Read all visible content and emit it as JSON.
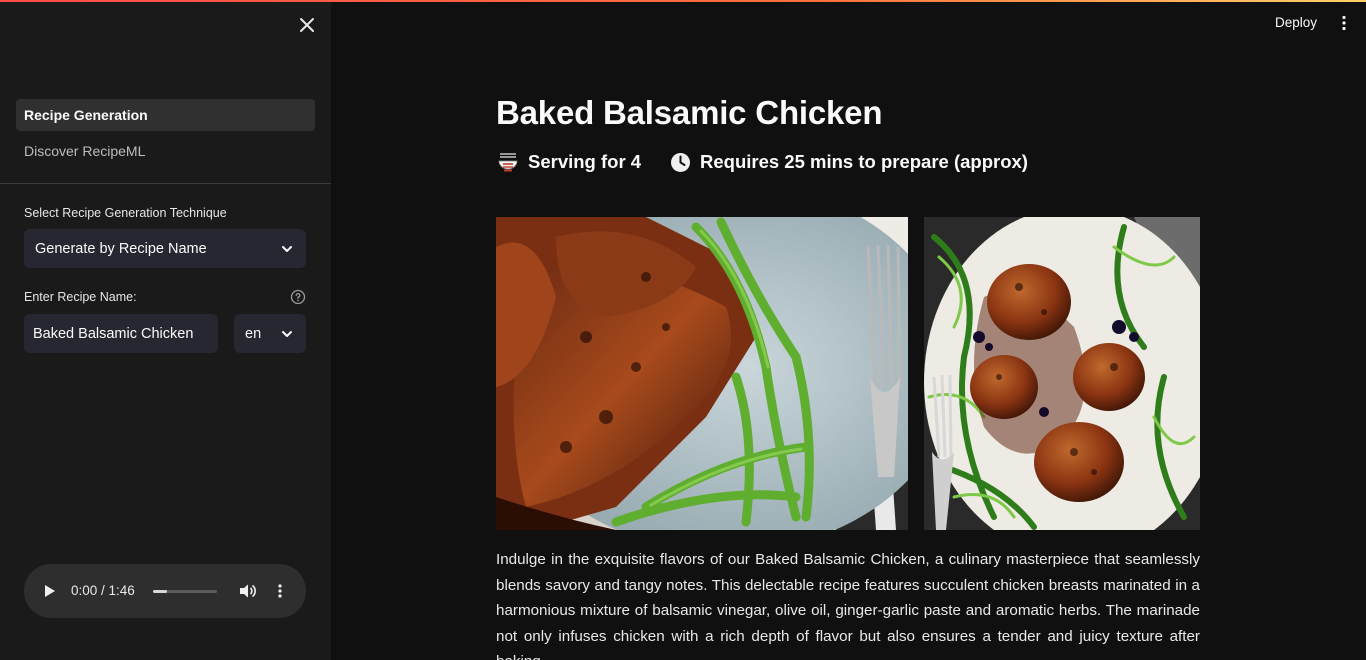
{
  "sidebar": {
    "nav": [
      {
        "label": "Recipe Generation",
        "active": true
      },
      {
        "label": "Discover RecipeML",
        "active": false
      }
    ],
    "technique_label": "Select Recipe Generation Technique",
    "technique_value": "Generate by Recipe Name",
    "name_label": "Enter Recipe Name:",
    "name_value": "Baked Balsamic Chicken",
    "language_value": "en",
    "audio": {
      "time": "0:00 / 1:46",
      "progress": 0.22
    }
  },
  "header": {
    "deploy_label": "Deploy"
  },
  "recipe": {
    "title": "Baked Balsamic Chicken",
    "serving": "Serving for 4",
    "prep_time": "Requires 25 mins to prepare (approx)",
    "description": "Indulge in the exquisite flavors of our Baked Balsamic Chicken, a culinary masterpiece that seamlessly blends savory and tangy notes. This delectable recipe features succulent chicken breasts marinated in a harmonious mixture of balsamic vinegar, olive oil, ginger-garlic paste and aromatic herbs. The marinade not only infuses chicken with a rich depth of flavor but also ensures a tender and juicy texture after baking"
  },
  "colors": {
    "accent": "#ff4b4b",
    "sidebar_bg": "#1a1a1a",
    "main_bg": "#101010",
    "input_bg": "#262730"
  }
}
